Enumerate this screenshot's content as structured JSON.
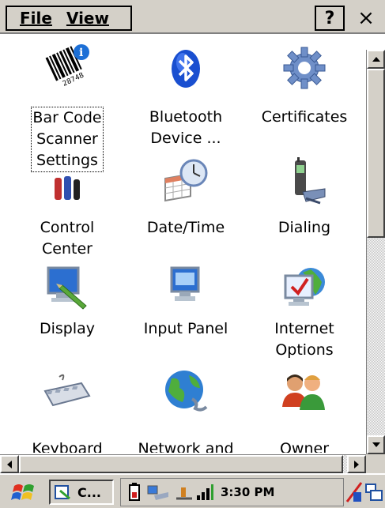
{
  "menu": {
    "file": "File",
    "view": "View",
    "help": "?",
    "close": "×"
  },
  "items": [
    {
      "label": "Bar Code\nScanner\nSettings",
      "icon": "barcode-icon",
      "barcode_text": "28748"
    },
    {
      "label": "Bluetooth\nDevice ...",
      "icon": "bluetooth-icon"
    },
    {
      "label": "Certificates",
      "icon": "gear-icon"
    },
    {
      "label": "Control\nCenter",
      "icon": "control-center-icon"
    },
    {
      "label": "Date/Time",
      "icon": "clock-icon"
    },
    {
      "label": "Dialing",
      "icon": "phone-icon"
    },
    {
      "label": "Display",
      "icon": "display-icon"
    },
    {
      "label": "Input Panel",
      "icon": "keyboard-panel-icon"
    },
    {
      "label": "Internet\nOptions",
      "icon": "globe-check-icon"
    },
    {
      "label": "Keyboard",
      "icon": "keyboard-icon"
    },
    {
      "label": "Network and",
      "icon": "network-globe-icon"
    },
    {
      "label": "Owner",
      "icon": "owner-users-icon"
    }
  ],
  "taskbar": {
    "task_label": "C...",
    "clock": "3:30 PM"
  },
  "colors": {
    "chrome": "#d4d0c8",
    "selection": "#000080"
  }
}
